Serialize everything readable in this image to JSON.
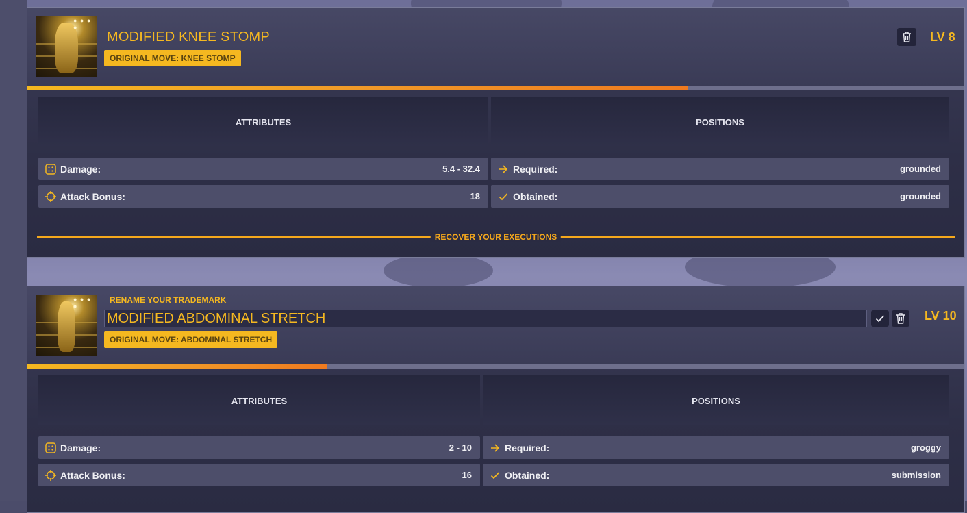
{
  "colors": {
    "accent": "#f5b820",
    "card_bg": "#2e2f47",
    "row_bg": "#4d4e6a",
    "progress_track": "#6e6f8c"
  },
  "cards": [
    {
      "title": "MODIFIED KNEE STOMP",
      "original_move": "ORIGINAL MOVE: KNEE STOMP",
      "level": "LV 8",
      "progress": 0.705,
      "attributes_header": "ATTRIBUTES",
      "positions_header": "POSITIONS",
      "damage_label": "Damage:",
      "damage_value": "5.4 - 32.4",
      "attack_label": "Attack Bonus:",
      "attack_value": "18",
      "required_label": "Required:",
      "required_value": "grounded",
      "obtained_label": "Obtained:",
      "obtained_value": "grounded",
      "recover_text": "RECOVER YOUR EXECUTIONS",
      "icons": {
        "delete": "trash-icon",
        "damage": "dice-icon",
        "attack": "crosshair-icon",
        "required": "arrow-right-icon",
        "obtained": "check-icon"
      }
    },
    {
      "rename_label": "RENAME YOUR TRADEMARK",
      "title": "MODIFIED ABDOMINAL STRETCH",
      "original_move": "ORIGINAL MOVE: ABDOMINAL STRETCH",
      "level": "LV 10",
      "progress": 0.32,
      "attributes_header": "ATTRIBUTES",
      "positions_header": "POSITIONS",
      "damage_label": "Damage:",
      "damage_value": "2 - 10",
      "attack_label": "Attack Bonus:",
      "attack_value": "16",
      "required_label": "Required:",
      "required_value": "groggy",
      "obtained_label": "Obtained:",
      "obtained_value": "submission",
      "icons": {
        "confirm": "check-icon",
        "delete": "trash-icon",
        "damage": "dice-icon",
        "attack": "crosshair-icon",
        "required": "arrow-right-icon",
        "obtained": "check-icon"
      }
    }
  ]
}
